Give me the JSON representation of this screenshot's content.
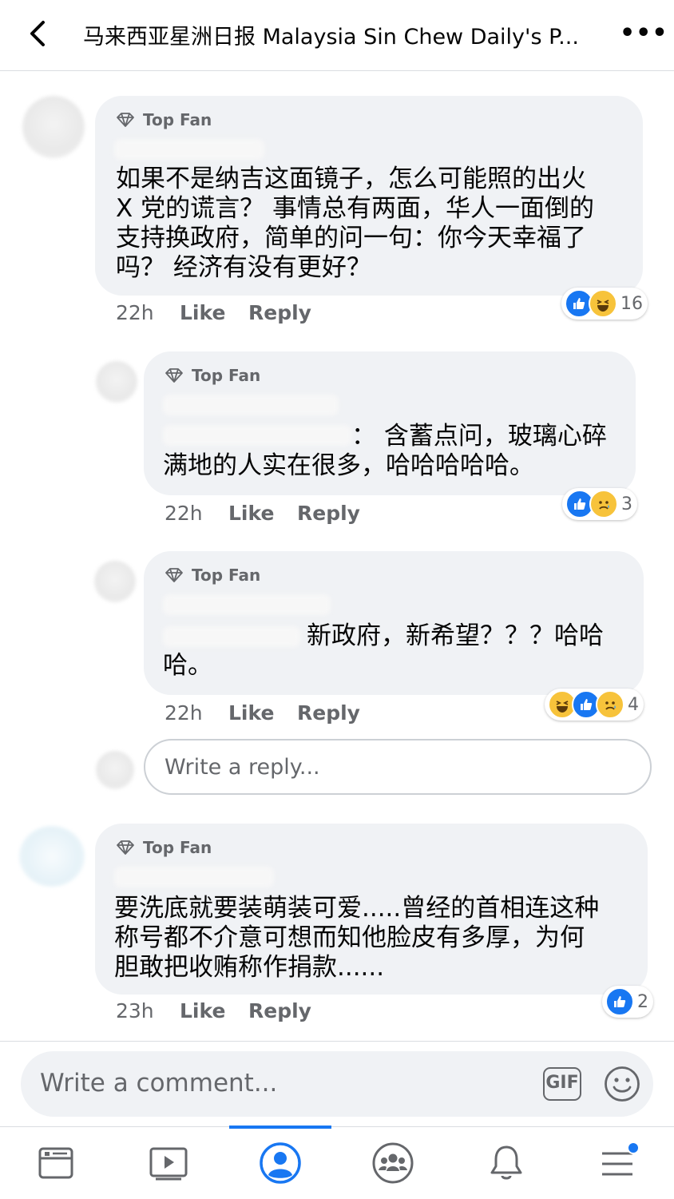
{
  "header": {
    "title": "马来西亚星洲日报 Malaysia Sin Chew Daily's P..."
  },
  "comments": [
    {
      "badge": "Top Fan",
      "text_lines": [
        "如果不是纳吉这面镜子，怎么可能照的出火",
        "X 党的谎言？ 事情总有两面，华人一面倒的",
        "支持换政府，简单的问一句：你今天幸福了",
        "吗？ 经济有没有更好？"
      ],
      "time": "22h",
      "like": "Like",
      "reply": "Reply",
      "reactions": [
        "like-icon",
        "haha-icon"
      ],
      "reaction_count": "16"
    },
    {
      "badge": "Top Fan",
      "text_lines": [
        "：  含蓄点问，玻璃心碎",
        "满地的人实在很多，哈哈哈哈哈。"
      ],
      "time": "22h",
      "like": "Like",
      "reply": "Reply",
      "reactions": [
        "like-icon",
        "sad-icon"
      ],
      "reaction_count": "3"
    },
    {
      "badge": "Top Fan",
      "text_lines": [
        "新政府，新希望？？？哈哈",
        "哈。"
      ],
      "time": "22h",
      "like": "Like",
      "reply": "Reply",
      "reactions": [
        "haha-icon",
        "like-icon",
        "sad-icon"
      ],
      "reaction_count": "4"
    },
    {
      "badge": "Top Fan",
      "text_lines": [
        "要洗底就要装萌装可爱.....曾经的首相连这种",
        "称号都不介意可想而知他脸皮有多厚，为何",
        "胆敢把收贿称作捐款......"
      ],
      "time": "23h",
      "like": "Like",
      "reply": "Reply",
      "reactions": [
        "like-icon"
      ],
      "reaction_count": "2"
    }
  ],
  "reply_box": {
    "placeholder": "Write a reply..."
  },
  "composer": {
    "placeholder": "Write a comment...",
    "gif_label": "GIF"
  },
  "tabs": [
    "news-feed-icon",
    "watch-icon",
    "profile-icon",
    "groups-icon",
    "notifications-icon",
    "menu-icon"
  ],
  "colors": {
    "accent": "#1877f2",
    "bubble": "#f0f2f5",
    "secondary_text": "#65676b"
  }
}
